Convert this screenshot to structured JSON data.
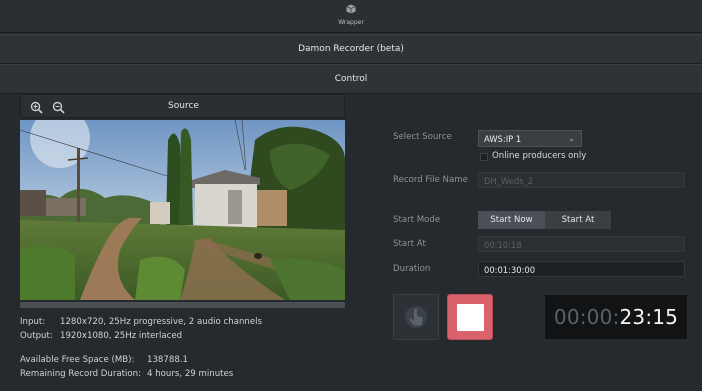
{
  "topbar": {
    "label": "Wrapper",
    "icon": "cube-icon"
  },
  "title_bar": {
    "label": "Damon Recorder (beta)"
  },
  "control_bar": {
    "label": "Control"
  },
  "source": {
    "title": "Source"
  },
  "info": {
    "input_key": "Input:",
    "input_value": "1280x720, 25Hz progressive, 2 audio channels",
    "output_key": "Output:",
    "output_value": "1920x1080, 25Hz interlaced",
    "free_space_key": "Available Free Space (MB):",
    "free_space_value": "138788.1",
    "remaining_key": "Remaining Record Duration:",
    "remaining_value": "4 hours, 29 minutes"
  },
  "form": {
    "select_source_label": "Select Source",
    "select_source_value": "AWS:IP 1",
    "online_only_label": "Online producers only",
    "online_only_checked": false,
    "record_file_label": "Record File Name",
    "record_file_value": "DH_Weds_2",
    "start_mode_label": "Start Mode",
    "start_mode_options": [
      "Start Now",
      "Start At"
    ],
    "start_mode_selected": "Start Now",
    "start_at_label": "Start At",
    "start_at_value": "00:10:18",
    "duration_label": "Duration",
    "duration_value": "00:01:30:00"
  },
  "timer": {
    "dim_part": "00:00:",
    "bright_part": "23:15"
  },
  "colors": {
    "stop_button": "#d9626c",
    "background": "#262a2e",
    "timer_bg": "#121314"
  }
}
